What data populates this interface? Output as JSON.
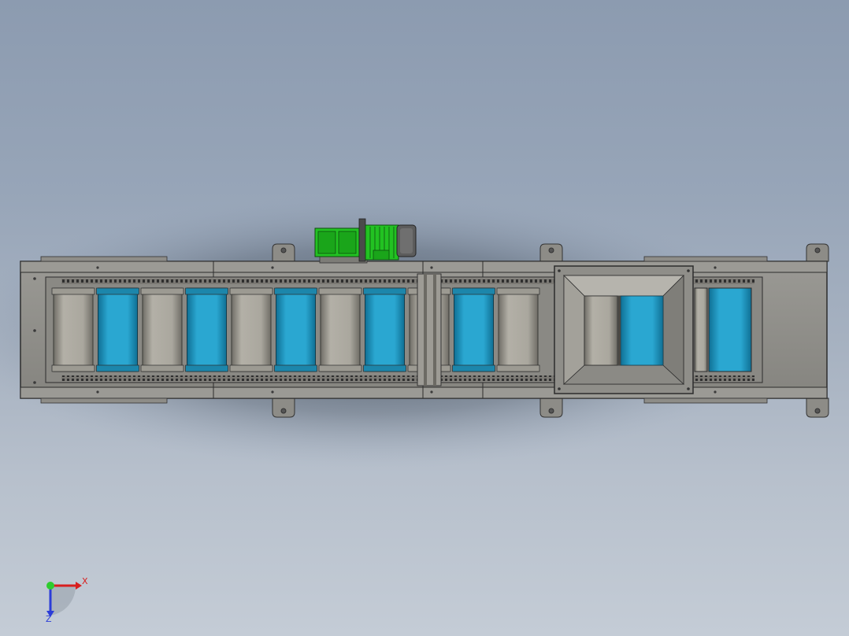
{
  "viewport": {
    "background_top": "#8c9bb0",
    "background_bottom": "#c4ccd6"
  },
  "model": {
    "frame_color": "#8f8f8a",
    "frame_edge": "#3b3b3b",
    "flight_color": "#1f9ec9",
    "flight_alt_color": "#a7a49b",
    "motor_color": "#22c222",
    "motor_housing": "#5c5c5c",
    "flight_pattern": [
      "gray",
      "blue",
      "gray",
      "blue",
      "gray",
      "blue",
      "gray",
      "blue",
      "gray",
      "blue",
      "gray",
      "blue",
      "gray",
      "blue"
    ]
  },
  "triad": {
    "x_label": "X",
    "z_label": "Z",
    "x_color": "#d81e1e",
    "y_color": "#2ecc2e",
    "z_color": "#2b3cd8"
  }
}
